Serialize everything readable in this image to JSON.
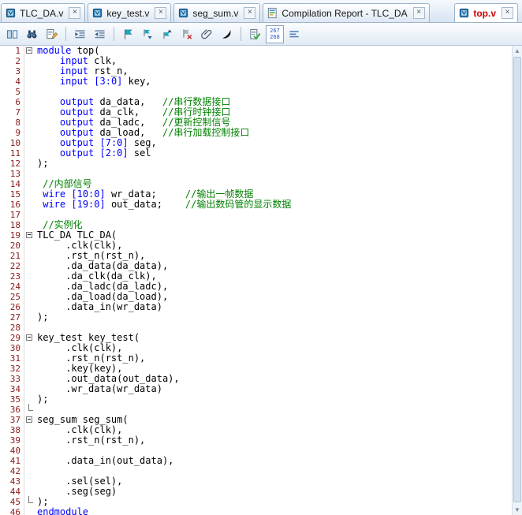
{
  "colors": {
    "keyword": "#0000ff",
    "comment": "#008000",
    "plain": "#000000",
    "line_number": "#8b1a1a",
    "active_tab_text": "#cc0000"
  },
  "tabs": [
    {
      "label": "TLC_DA.v",
      "icon": "verilog-file-icon",
      "active": false
    },
    {
      "label": "key_test.v",
      "icon": "verilog-file-icon",
      "active": false
    },
    {
      "label": "seg_sum.v",
      "icon": "verilog-file-icon",
      "active": false
    },
    {
      "label": "Compilation Report - TLC_DA",
      "icon": "report-icon",
      "active": false
    },
    {
      "label": "top.v",
      "icon": "verilog-file-icon",
      "active": true
    }
  ],
  "tab_close_glyph": "×",
  "toolbar": {
    "items": [
      {
        "name": "split-pane-icon"
      },
      {
        "name": "find-icon"
      },
      {
        "name": "replace-icon"
      },
      {
        "sep": true
      },
      {
        "name": "increase-indent-icon"
      },
      {
        "name": "decrease-indent-icon"
      },
      {
        "sep": true
      },
      {
        "name": "toggle-bookmark-icon"
      },
      {
        "name": "next-bookmark-icon"
      },
      {
        "name": "previous-bookmark-icon"
      },
      {
        "name": "clear-bookmarks-icon"
      },
      {
        "name": "attach-file-icon"
      },
      {
        "name": "insert-template-icon"
      },
      {
        "sep": true
      },
      {
        "name": "analyze-icon"
      },
      {
        "name": "line-counter",
        "counter": [
          "267",
          "268"
        ]
      },
      {
        "name": "tab-lines-icon"
      }
    ]
  },
  "scrollbar": {
    "up_glyph": "▲",
    "down_glyph": "▼"
  },
  "editor": {
    "filename": "top.v",
    "lines": [
      {
        "n": 1,
        "fold": "start",
        "segs": [
          [
            "k",
            "module"
          ],
          [
            "p",
            " top("
          ]
        ]
      },
      {
        "n": 2,
        "segs": [
          [
            "p",
            "    "
          ],
          [
            "k",
            "input"
          ],
          [
            "p",
            " clk,"
          ]
        ]
      },
      {
        "n": 3,
        "segs": [
          [
            "p",
            "    "
          ],
          [
            "k",
            "input"
          ],
          [
            "p",
            " rst_n,"
          ]
        ]
      },
      {
        "n": 4,
        "segs": [
          [
            "p",
            "    "
          ],
          [
            "k",
            "input"
          ],
          [
            "p",
            " "
          ],
          [
            "k",
            "[3:0]"
          ],
          [
            "p",
            " key,"
          ]
        ]
      },
      {
        "n": 5,
        "segs": []
      },
      {
        "n": 6,
        "segs": [
          [
            "p",
            "    "
          ],
          [
            "k",
            "output"
          ],
          [
            "p",
            " da_data,   "
          ],
          [
            "c",
            "//串行数据接口"
          ]
        ]
      },
      {
        "n": 7,
        "segs": [
          [
            "p",
            "    "
          ],
          [
            "k",
            "output"
          ],
          [
            "p",
            " da_clk,    "
          ],
          [
            "c",
            "//串行时钟接口"
          ]
        ]
      },
      {
        "n": 8,
        "segs": [
          [
            "p",
            "    "
          ],
          [
            "k",
            "output"
          ],
          [
            "p",
            " da_ladc,   "
          ],
          [
            "c",
            "//更新控制信号"
          ]
        ]
      },
      {
        "n": 9,
        "segs": [
          [
            "p",
            "    "
          ],
          [
            "k",
            "output"
          ],
          [
            "p",
            " da_load,   "
          ],
          [
            "c",
            "//串行加载控制接口"
          ]
        ]
      },
      {
        "n": 10,
        "segs": [
          [
            "p",
            "    "
          ],
          [
            "k",
            "output"
          ],
          [
            "p",
            " "
          ],
          [
            "k",
            "[7:0]"
          ],
          [
            "p",
            " seg,"
          ]
        ]
      },
      {
        "n": 11,
        "segs": [
          [
            "p",
            "    "
          ],
          [
            "k",
            "output"
          ],
          [
            "p",
            " "
          ],
          [
            "k",
            "[2:0]"
          ],
          [
            "p",
            " sel"
          ]
        ]
      },
      {
        "n": 12,
        "segs": [
          [
            "p",
            ");"
          ]
        ]
      },
      {
        "n": 13,
        "segs": []
      },
      {
        "n": 14,
        "segs": [
          [
            "p",
            " "
          ],
          [
            "c",
            "//内部信号"
          ]
        ]
      },
      {
        "n": 15,
        "segs": [
          [
            "p",
            " "
          ],
          [
            "k",
            "wire"
          ],
          [
            "p",
            " "
          ],
          [
            "k",
            "[10:0]"
          ],
          [
            "p",
            " wr_data;     "
          ],
          [
            "c",
            "//输出一帧数据"
          ]
        ]
      },
      {
        "n": 16,
        "segs": [
          [
            "p",
            " "
          ],
          [
            "k",
            "wire"
          ],
          [
            "p",
            " "
          ],
          [
            "k",
            "[19:0]"
          ],
          [
            "p",
            " out_data;    "
          ],
          [
            "c",
            "//输出数码管的显示数据"
          ]
        ]
      },
      {
        "n": 17,
        "segs": []
      },
      {
        "n": 18,
        "segs": [
          [
            "p",
            " "
          ],
          [
            "c",
            "//实例化"
          ]
        ]
      },
      {
        "n": 19,
        "fold": "start",
        "segs": [
          [
            "p",
            "TLC_DA TLC_DA("
          ]
        ]
      },
      {
        "n": 20,
        "segs": [
          [
            "p",
            "     .clk(clk),"
          ]
        ]
      },
      {
        "n": 21,
        "segs": [
          [
            "p",
            "     .rst_n(rst_n),"
          ]
        ]
      },
      {
        "n": 22,
        "segs": [
          [
            "p",
            "     .da_data(da_data),"
          ]
        ]
      },
      {
        "n": 23,
        "segs": [
          [
            "p",
            "     .da_clk(da_clk),"
          ]
        ]
      },
      {
        "n": 24,
        "segs": [
          [
            "p",
            "     .da_ladc(da_ladc),"
          ]
        ]
      },
      {
        "n": 25,
        "segs": [
          [
            "p",
            "     .da_load(da_load),"
          ]
        ]
      },
      {
        "n": 26,
        "segs": [
          [
            "p",
            "     .data_in(wr_data)"
          ]
        ]
      },
      {
        "n": 27,
        "segs": [
          [
            "p",
            ");"
          ]
        ]
      },
      {
        "n": 28,
        "segs": []
      },
      {
        "n": 29,
        "fold": "start",
        "segs": [
          [
            "p",
            "key_test key_test("
          ]
        ]
      },
      {
        "n": 30,
        "segs": [
          [
            "p",
            "     .clk(clk),"
          ]
        ]
      },
      {
        "n": 31,
        "segs": [
          [
            "p",
            "     .rst_n(rst_n),"
          ]
        ]
      },
      {
        "n": 32,
        "segs": [
          [
            "p",
            "     .key(key),"
          ]
        ]
      },
      {
        "n": 33,
        "segs": [
          [
            "p",
            "     .out_data(out_data),"
          ]
        ]
      },
      {
        "n": 34,
        "segs": [
          [
            "p",
            "     .wr_data(wr_data)"
          ]
        ]
      },
      {
        "n": 35,
        "segs": [
          [
            "p",
            ");"
          ]
        ]
      },
      {
        "n": 36,
        "fold": "end",
        "segs": []
      },
      {
        "n": 37,
        "fold": "start",
        "segs": [
          [
            "p",
            "seg_sum seg_sum("
          ]
        ]
      },
      {
        "n": 38,
        "segs": [
          [
            "p",
            "     .clk(clk),"
          ]
        ]
      },
      {
        "n": 39,
        "segs": [
          [
            "p",
            "     .rst_n(rst_n),"
          ]
        ]
      },
      {
        "n": 40,
        "segs": []
      },
      {
        "n": 41,
        "segs": [
          [
            "p",
            "     .data_in(out_data),"
          ]
        ]
      },
      {
        "n": 42,
        "segs": []
      },
      {
        "n": 43,
        "segs": [
          [
            "p",
            "     .sel(sel),"
          ]
        ]
      },
      {
        "n": 44,
        "segs": [
          [
            "p",
            "     .seg(seg)"
          ]
        ]
      },
      {
        "n": 45,
        "fold": "end",
        "segs": [
          [
            "p",
            ");"
          ]
        ]
      },
      {
        "n": 46,
        "segs": [
          [
            "k",
            "endmodule"
          ]
        ]
      }
    ]
  }
}
